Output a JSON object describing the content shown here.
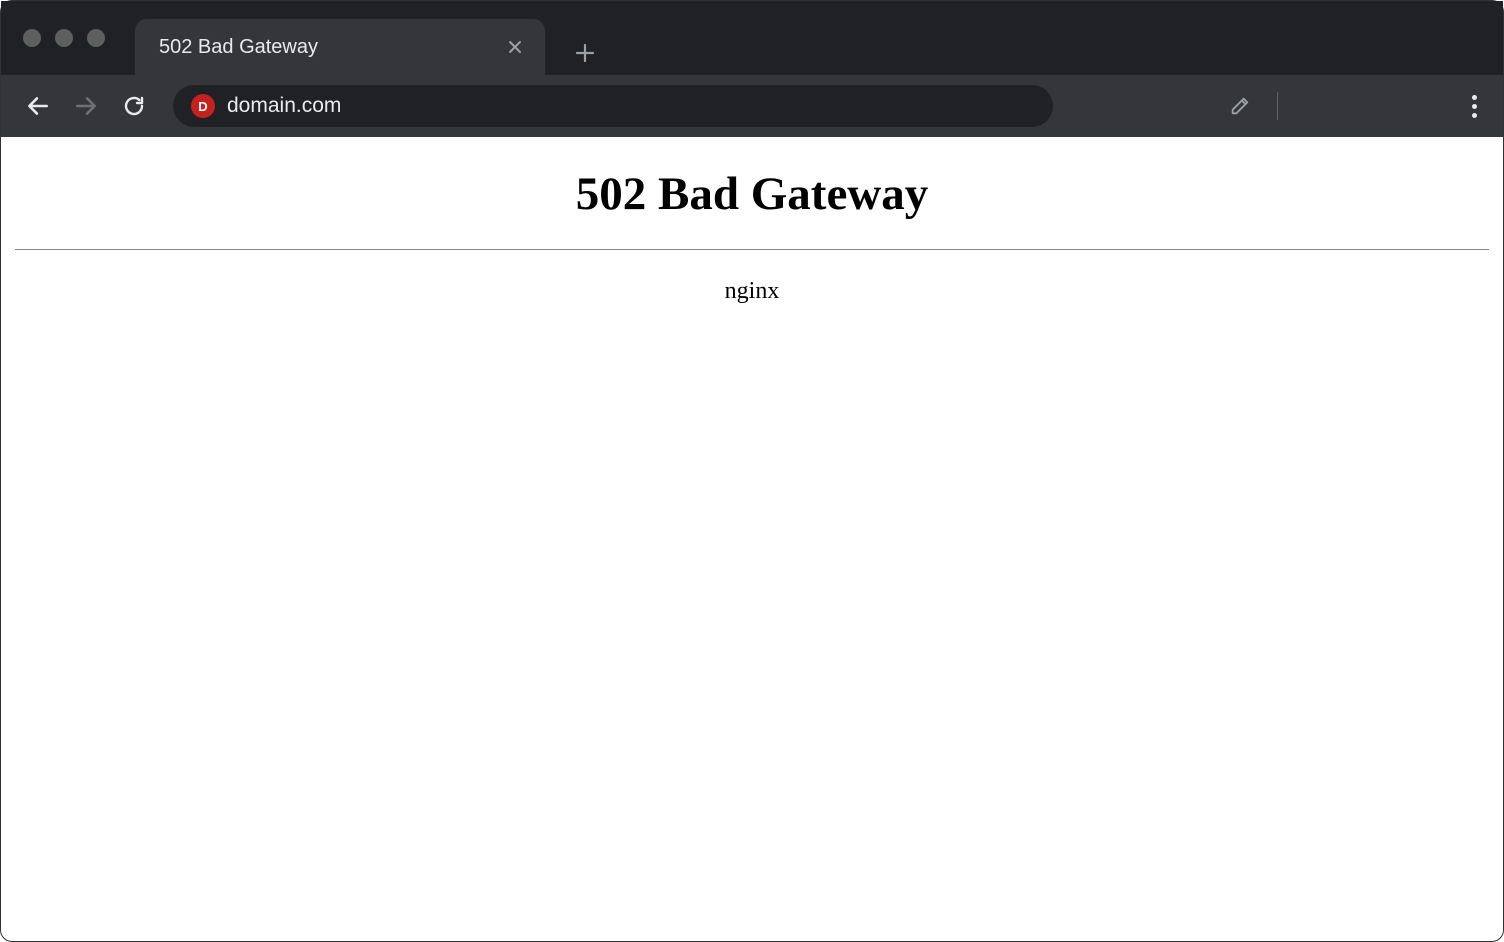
{
  "browser": {
    "tab_title": "502 Bad Gateway",
    "address": "domain.com",
    "favicon_letter": "D"
  },
  "page": {
    "heading": "502 Bad Gateway",
    "server": "nginx"
  }
}
